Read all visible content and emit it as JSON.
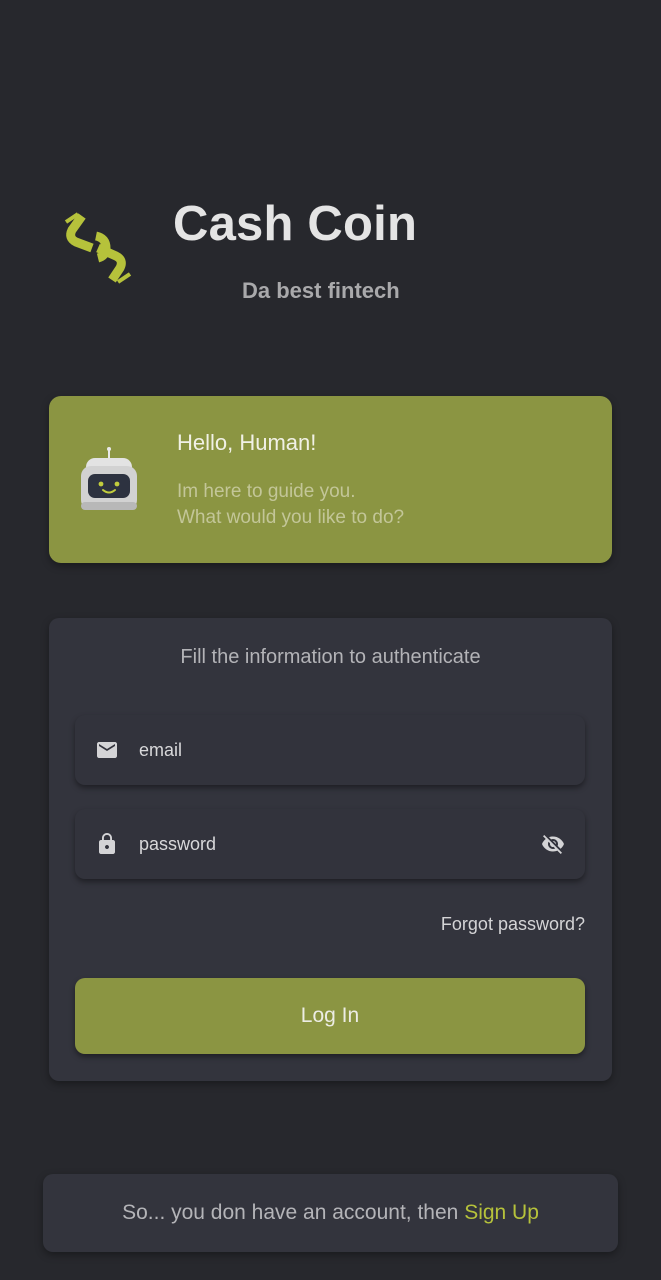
{
  "header": {
    "app_title": "Cash Coin",
    "app_subtitle": "Da best fintech",
    "logo_icon": "chain-link-logo-icon"
  },
  "bot_card": {
    "greeting": "Hello, Human!",
    "line1": "Im here to guide you.",
    "line2": "What would you like to do?",
    "icon": "robot-icon"
  },
  "auth": {
    "heading": "Fill the information to authenticate",
    "email_placeholder": "email",
    "email_icon": "mail-icon",
    "password_placeholder": "password",
    "password_icon": "lock-icon",
    "visibility_icon": "eye-off-icon",
    "forgot_label": "Forgot password?",
    "login_label": "Log In"
  },
  "signup": {
    "prompt": "So... you don have an account, then ",
    "link_label": "Sign Up"
  },
  "colors": {
    "background": "#27282d",
    "card": "#33343d",
    "accent": "#8b9542",
    "link": "#b6c23b"
  }
}
